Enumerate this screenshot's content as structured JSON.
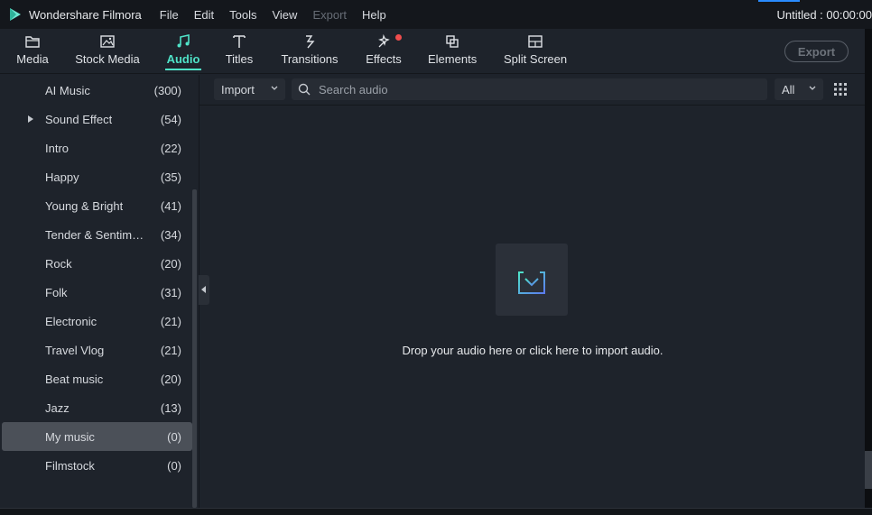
{
  "app": {
    "name": "Wondershare Filmora",
    "project_title": "Untitled : 00:00:00",
    "menu": [
      {
        "label": "File",
        "enabled": true
      },
      {
        "label": "Edit",
        "enabled": true
      },
      {
        "label": "Tools",
        "enabled": true
      },
      {
        "label": "View",
        "enabled": true
      },
      {
        "label": "Export",
        "enabled": false
      },
      {
        "label": "Help",
        "enabled": true
      }
    ]
  },
  "toolbar": {
    "tabs": [
      {
        "id": "media",
        "label": "Media",
        "icon": "folder-icon",
        "active": false
      },
      {
        "id": "stock-media",
        "label": "Stock Media",
        "icon": "stock-image-icon",
        "active": false
      },
      {
        "id": "audio",
        "label": "Audio",
        "icon": "music-note-icon",
        "active": true
      },
      {
        "id": "titles",
        "label": "Titles",
        "icon": "text-t-icon",
        "active": false
      },
      {
        "id": "transitions",
        "label": "Transitions",
        "icon": "transition-icon",
        "active": false
      },
      {
        "id": "effects",
        "label": "Effects",
        "icon": "effects-sparkle-icon",
        "active": false,
        "badge": true
      },
      {
        "id": "elements",
        "label": "Elements",
        "icon": "elements-icon",
        "active": false
      },
      {
        "id": "split-screen",
        "label": "Split Screen",
        "icon": "split-screen-icon",
        "active": false
      }
    ],
    "export_label": "Export",
    "accent": "#4fe3c8"
  },
  "sidebar": {
    "categories": [
      {
        "label": "AI Music",
        "count": "(300)",
        "expandable": false,
        "selected": false
      },
      {
        "label": "Sound Effect",
        "count": "(54)",
        "expandable": true,
        "selected": false
      },
      {
        "label": "Intro",
        "count": "(22)",
        "expandable": false,
        "selected": false
      },
      {
        "label": "Happy",
        "count": "(35)",
        "expandable": false,
        "selected": false
      },
      {
        "label": "Young & Bright",
        "count": "(41)",
        "expandable": false,
        "selected": false
      },
      {
        "label": "Tender & Sentimental",
        "count": "(34)",
        "expandable": false,
        "selected": false
      },
      {
        "label": "Rock",
        "count": "(20)",
        "expandable": false,
        "selected": false
      },
      {
        "label": "Folk",
        "count": "(31)",
        "expandable": false,
        "selected": false
      },
      {
        "label": "Electronic",
        "count": "(21)",
        "expandable": false,
        "selected": false
      },
      {
        "label": "Travel Vlog",
        "count": "(21)",
        "expandable": false,
        "selected": false
      },
      {
        "label": "Beat music",
        "count": "(20)",
        "expandable": false,
        "selected": false
      },
      {
        "label": "Jazz",
        "count": "(13)",
        "expandable": false,
        "selected": false
      },
      {
        "label": "My music",
        "count": "(0)",
        "expandable": false,
        "selected": true
      },
      {
        "label": "Filmstock",
        "count": "(0)",
        "expandable": false,
        "selected": false
      }
    ]
  },
  "content": {
    "import_label": "Import",
    "search_placeholder": "Search audio",
    "filter_label": "All",
    "drop_text": "Drop your audio here or click here to import audio."
  }
}
